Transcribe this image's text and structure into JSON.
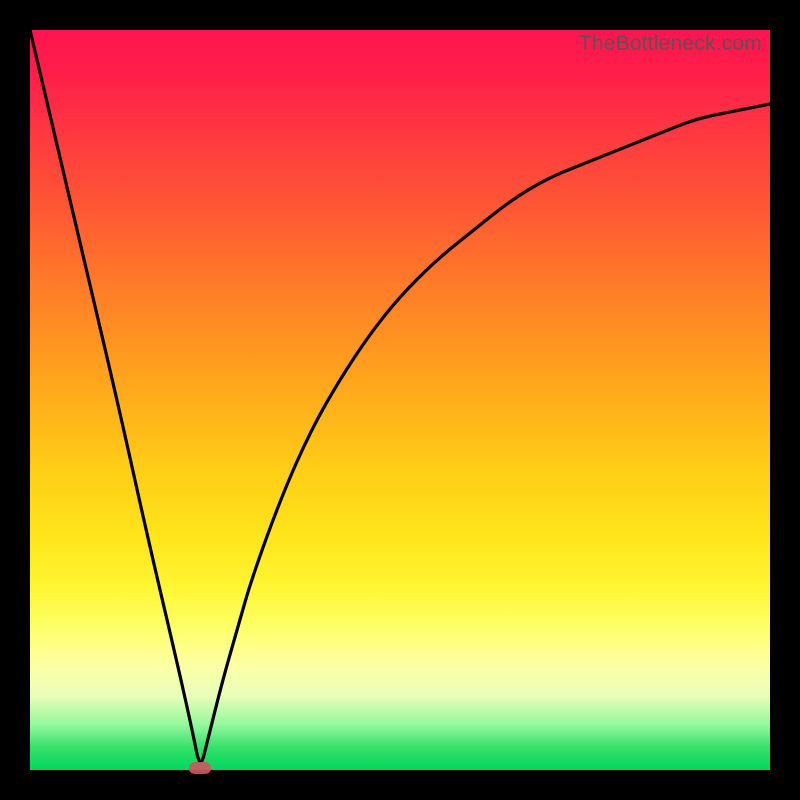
{
  "watermark": "TheBottleneck.com",
  "chart_data": {
    "type": "line",
    "title": "",
    "xlabel": "",
    "ylabel": "",
    "xlim": [
      0,
      100
    ],
    "ylim": [
      0,
      100
    ],
    "grid": false,
    "legend": false,
    "annotations": [],
    "background_gradient": {
      "direction": "vertical",
      "stops": [
        {
          "pos": 0.0,
          "color": "#ff1450"
        },
        {
          "pos": 0.25,
          "color": "#ff6a2a"
        },
        {
          "pos": 0.55,
          "color": "#ffc717"
        },
        {
          "pos": 0.8,
          "color": "#feff60"
        },
        {
          "pos": 0.95,
          "color": "#5de97f"
        },
        {
          "pos": 1.0,
          "color": "#00d85c"
        }
      ]
    },
    "minimum_marker": {
      "x": 23,
      "y": 0,
      "color": "#c95a5f"
    },
    "series": [
      {
        "name": "curve",
        "x": [
          0,
          4,
          8,
          12,
          16,
          20,
          22,
          23,
          24,
          26,
          28,
          30,
          34,
          38,
          42,
          46,
          50,
          55,
          60,
          65,
          70,
          75,
          80,
          85,
          90,
          95,
          100
        ],
        "y": [
          100,
          83,
          66,
          49,
          31,
          14,
          5,
          0,
          4,
          12,
          19,
          26,
          37,
          46,
          53,
          59,
          64,
          69,
          73,
          77,
          80,
          82,
          84,
          86,
          88,
          89,
          90
        ]
      }
    ]
  }
}
